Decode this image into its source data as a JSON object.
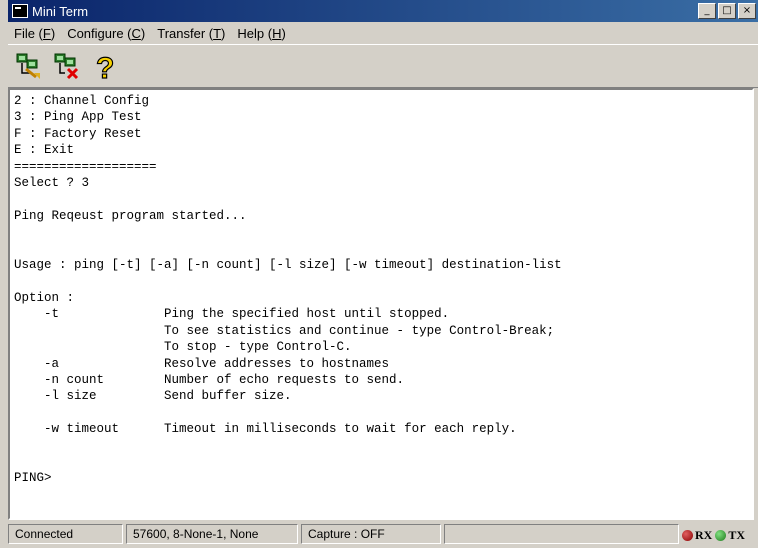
{
  "window": {
    "title": "Mini Term"
  },
  "menu": [
    {
      "label": "File (",
      "key": "F",
      "end": ")"
    },
    {
      "label": "Configure (",
      "key": "C",
      "end": ")"
    },
    {
      "label": "Transfer (",
      "key": "T",
      "end": ")"
    },
    {
      "label": "Help (",
      "key": "H",
      "end": ")"
    }
  ],
  "toolbar": {
    "icons": [
      "connect-icon",
      "disconnect-icon",
      "help-icon"
    ]
  },
  "terminal": {
    "lines": [
      "2 : Channel Config",
      "3 : Ping App Test",
      "F : Factory Reset",
      "E : Exit",
      "===================",
      "Select ? 3",
      "",
      "Ping Reqeust program started...",
      "",
      "",
      "Usage : ping [-t] [-a] [-n count] [-l size] [-w timeout] destination-list",
      "",
      "Option :",
      "    -t              Ping the specified host until stopped.",
      "                    To see statistics and continue - type Control-Break;",
      "                    To stop - type Control-C.",
      "    -a              Resolve addresses to hostnames",
      "    -n count        Number of echo requests to send.",
      "    -l size         Send buffer size.",
      "",
      "    -w timeout      Timeout in milliseconds to wait for each reply.",
      "",
      "",
      "PING>"
    ]
  },
  "status": {
    "connection": "Connected",
    "settings": "57600, 8-None-1, None",
    "capture": "Capture : OFF",
    "rx": "RX",
    "tx": "TX",
    "rx_color": "#8b0000",
    "tx_color": "#1e7a1e"
  }
}
